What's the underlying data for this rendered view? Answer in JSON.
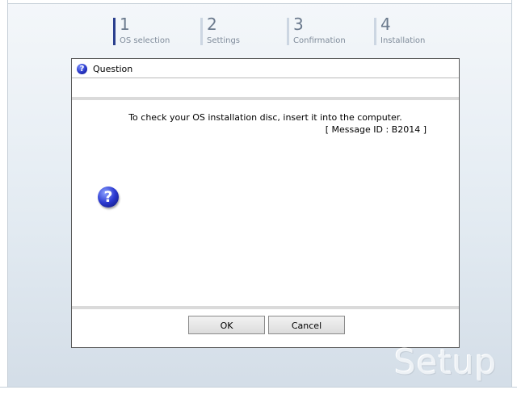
{
  "steps": [
    {
      "num": "1",
      "label": "OS selection"
    },
    {
      "num": "2",
      "label": "Settings"
    },
    {
      "num": "3",
      "label": "Confirmation"
    },
    {
      "num": "4",
      "label": "Installation"
    }
  ],
  "dialog": {
    "title": "Question",
    "message": "To check your OS installation disc, insert it into the computer.",
    "message_id": "[ Message ID : B2014 ]",
    "ok_label": "OK",
    "cancel_label": "Cancel"
  },
  "watermark": "Setup",
  "icons": {
    "title_icon": "question-icon",
    "body_icon": "question-icon"
  },
  "colors": {
    "active_step_bar": "#2b3f8e",
    "inactive_step_bar": "#ccd6e2",
    "question_icon": "#2a38c8"
  }
}
